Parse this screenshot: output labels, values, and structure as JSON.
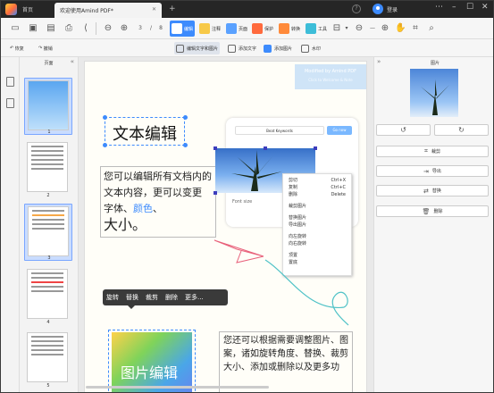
{
  "titlebar": {
    "home": "首页",
    "tab_title": "欢迎使用Amind PDF*",
    "login": "登录"
  },
  "toolbar": {
    "page_current": "3",
    "page_total": "8",
    "edit": "编辑",
    "annotate": "注释",
    "page": "页面",
    "protect": "保护",
    "convert": "转换",
    "tools": "工具"
  },
  "subtoolbar": {
    "undo": "恢复",
    "redo": "撤销",
    "edit_text_image": "编辑文字和图片",
    "add_text": "添加文字",
    "add_image": "添加图片",
    "crop": "水印"
  },
  "thumbs": {
    "header": "页面",
    "pages": [
      "1",
      "2",
      "3",
      "4",
      "5"
    ]
  },
  "doc": {
    "banner_title": "Modified by Amind PDF",
    "banner_sub": "Click to Welcome & Note",
    "title": "文本编辑",
    "para1_a": "您可以编辑所有文档内的文本内容，更可以变更 字体、",
    "para1_color": "颜色",
    "para1_b": "、",
    "para1_big": "大小。",
    "search_placeholder": "Beat Keywords",
    "search_btn": "Go now",
    "font_size": "Font size",
    "context_menu": [
      {
        "label": "剪切",
        "shortcut": "Ctrl+X"
      },
      {
        "label": "复制",
        "shortcut": "Ctrl+C"
      },
      {
        "label": "删除",
        "shortcut": "Delete"
      },
      {
        "label": "",
        "shortcut": ""
      },
      {
        "label": "裁剪图片",
        "shortcut": ""
      },
      {
        "label": "",
        "shortcut": ""
      },
      {
        "label": "替换图片",
        "shortcut": ""
      },
      {
        "label": "导出图片",
        "shortcut": ""
      },
      {
        "label": "",
        "shortcut": ""
      },
      {
        "label": "向左旋转",
        "shortcut": ""
      },
      {
        "label": "向右旋转",
        "shortcut": ""
      },
      {
        "label": "",
        "shortcut": ""
      },
      {
        "label": "顶置",
        "shortcut": ""
      },
      {
        "label": "置底",
        "shortcut": ""
      }
    ],
    "ctxbar": [
      "旋转",
      "替换",
      "裁剪",
      "删除",
      "更多..."
    ],
    "image_label": "图片编辑",
    "para2": "您还可以根据需要调整图片、图案，诸如旋转角度、替换、裁剪大小、添加或删除以及更多功"
  },
  "right": {
    "header": "图片",
    "crop": "裁剪",
    "export": "导出",
    "replace": "替换",
    "delete": "删除"
  }
}
